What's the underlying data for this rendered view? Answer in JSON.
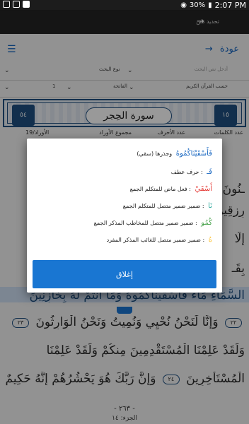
{
  "status": {
    "battery": "30%",
    "time": "2:07 PM"
  },
  "appbar": {
    "title": "تحديد نص"
  },
  "toolbar": {
    "back_label": "عودة",
    "menu_icon": "hamburger-icon",
    "back_icon": "arrow-right-icon"
  },
  "search": {
    "placeholder": "أدخل نص البحث",
    "search_type": "حسب القرآن الكريم"
  },
  "selectors": {
    "search_type_label": "نوع البحث",
    "sura_value": "الفاتحة",
    "verse_value": "1"
  },
  "sura_banner": {
    "name": "سورة الحِجر",
    "number_left": "٥٤",
    "number_right": "١٥"
  },
  "meta": {
    "words": "عدد الكلمات",
    "letters": "عدد الأحرف",
    "verses": "مجموع الأوراد",
    "parts": "الأوراد/19"
  },
  "verses": {
    "l1": "ـنُونَ",
    "l2": "رِزقِينَ",
    "l3": "إِلَّا",
    "l4": "بِقَـ",
    "l5": "السَّمَاءِ مَاءً فَأَسْقَيْنَاكُمُوهُ وَمَا أَنتُمْ لَهُ بِخَازِنِينَ",
    "l6": "وَإِنَّا لَنَحْنُ نُحْيِي وَنُمِيتُ وَنَحْنُ الْوَارِثُونَ",
    "l6_num": "٢٣",
    "l7": "وَلَقَدْ عَلِمْنَا الْمُسْتَقْدِمِينَ مِنكُمْ وَلَقَدْ عَلِمْنَا",
    "l8": "الْمُسْتَأْخِرِينَ",
    "l8_num": "٢٤",
    "l9": "وَإِنَّ رَبَّكَ هُوَ يَحْشُرُهُمْ إِنَّهُ حَكِيمٌ",
    "l6_prefix_num": "٢٢",
    "footer_page": "- ٢٦٣ -",
    "footer_part": "الجزء: ١٤"
  },
  "dialog": {
    "word": "فَأَسْقَيْنَاكُمُوهُ",
    "word_root": "وجذرها (سقي)",
    "parts": [
      {
        "token": "فَـ",
        "color": "#1565c0",
        "text": ": حرف عطف"
      },
      {
        "token": "أَسْقَيْ",
        "color": "#e53935",
        "text": ": فعل ماض للمتكلم الجمع"
      },
      {
        "token": "نَا",
        "color": "#26a69a",
        "text": ": ضمير ضمير متصل للمتكلم الجمع"
      },
      {
        "token": "كُمُو",
        "color": "#43a047",
        "text": ": ضمير ضمير متصل للمخاطب المذكر الجمع"
      },
      {
        "token": "هُ",
        "color": "#fbc02d",
        "text": ": ضمير ضمير متصل للغائب المذكر المفرد"
      }
    ],
    "close_label": "إغلاق"
  }
}
